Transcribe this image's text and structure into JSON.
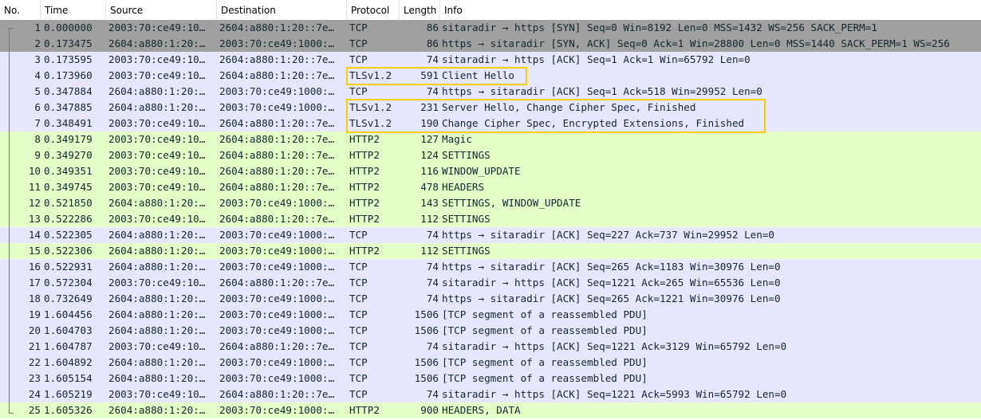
{
  "columns": {
    "no": "No.",
    "time": "Time",
    "source": "Source",
    "destination": "Destination",
    "protocol": "Protocol",
    "length": "Length",
    "info": "Info"
  },
  "packets": [
    {
      "no": "1",
      "time": "0.000000",
      "src": "2003:70:ce49:10…",
      "dst": "2604:a880:1:20::7e…",
      "proto": "TCP",
      "len": "86",
      "info": "sitaradir → https [SYN] Seq=0 Win=8192 Len=0 MSS=1432 WS=256 SACK_PERM=1",
      "kind": "selected"
    },
    {
      "no": "2",
      "time": "0.173475",
      "src": "2604:a880:1:20:…",
      "dst": "2003:70:ce49:1000:…",
      "proto": "TCP",
      "len": "86",
      "info": "https → sitaradir [SYN, ACK] Seq=0 Ack=1 Win=28800 Len=0 MSS=1440 SACK_PERM=1 WS=256",
      "kind": "selected"
    },
    {
      "no": "3",
      "time": "0.173595",
      "src": "2003:70:ce49:10…",
      "dst": "2604:a880:1:20::7e…",
      "proto": "TCP",
      "len": "74",
      "info": "sitaradir → https [ACK] Seq=1 Ack=1 Win=65792 Len=0",
      "kind": "tcp"
    },
    {
      "no": "4",
      "time": "0.173960",
      "src": "2003:70:ce49:10…",
      "dst": "2604:a880:1:20::7e…",
      "proto": "TLSv1.2",
      "len": "591",
      "info": "Client Hello",
      "kind": "tls"
    },
    {
      "no": "5",
      "time": "0.347884",
      "src": "2604:a880:1:20:…",
      "dst": "2003:70:ce49:1000:…",
      "proto": "TCP",
      "len": "74",
      "info": "https → sitaradir [ACK] Seq=1 Ack=518 Win=29952 Len=0",
      "kind": "tcp"
    },
    {
      "no": "6",
      "time": "0.347885",
      "src": "2604:a880:1:20:…",
      "dst": "2003:70:ce49:1000:…",
      "proto": "TLSv1.2",
      "len": "231",
      "info": "Server Hello, Change Cipher Spec, Finished",
      "kind": "tls"
    },
    {
      "no": "7",
      "time": "0.348491",
      "src": "2003:70:ce49:10…",
      "dst": "2604:a880:1:20::7e…",
      "proto": "TLSv1.2",
      "len": "190",
      "info": "Change Cipher Spec, Encrypted Extensions, Finished",
      "kind": "tls"
    },
    {
      "no": "8",
      "time": "0.349179",
      "src": "2003:70:ce49:10…",
      "dst": "2604:a880:1:20::7e…",
      "proto": "HTTP2",
      "len": "127",
      "info": "Magic",
      "kind": "http2"
    },
    {
      "no": "9",
      "time": "0.349270",
      "src": "2003:70:ce49:10…",
      "dst": "2604:a880:1:20::7e…",
      "proto": "HTTP2",
      "len": "124",
      "info": "SETTINGS",
      "kind": "http2"
    },
    {
      "no": "10",
      "time": "0.349351",
      "src": "2003:70:ce49:10…",
      "dst": "2604:a880:1:20::7e…",
      "proto": "HTTP2",
      "len": "116",
      "info": "WINDOW_UPDATE",
      "kind": "http2"
    },
    {
      "no": "11",
      "time": "0.349745",
      "src": "2003:70:ce49:10…",
      "dst": "2604:a880:1:20::7e…",
      "proto": "HTTP2",
      "len": "478",
      "info": "HEADERS",
      "kind": "http2"
    },
    {
      "no": "12",
      "time": "0.521850",
      "src": "2604:a880:1:20:…",
      "dst": "2003:70:ce49:1000:…",
      "proto": "HTTP2",
      "len": "143",
      "info": "SETTINGS, WINDOW_UPDATE",
      "kind": "http2"
    },
    {
      "no": "13",
      "time": "0.522286",
      "src": "2003:70:ce49:10…",
      "dst": "2604:a880:1:20::7e…",
      "proto": "HTTP2",
      "len": "112",
      "info": "SETTINGS",
      "kind": "http2"
    },
    {
      "no": "14",
      "time": "0.522305",
      "src": "2604:a880:1:20:…",
      "dst": "2003:70:ce49:1000:…",
      "proto": "TCP",
      "len": "74",
      "info": "https → sitaradir [ACK] Seq=227 Ack=737 Win=29952 Len=0",
      "kind": "tcp"
    },
    {
      "no": "15",
      "time": "0.522306",
      "src": "2604:a880:1:20:…",
      "dst": "2003:70:ce49:1000:…",
      "proto": "HTTP2",
      "len": "112",
      "info": "SETTINGS",
      "kind": "http2"
    },
    {
      "no": "16",
      "time": "0.522931",
      "src": "2604:a880:1:20:…",
      "dst": "2003:70:ce49:1000:…",
      "proto": "TCP",
      "len": "74",
      "info": "https → sitaradir [ACK] Seq=265 Ack=1183 Win=30976 Len=0",
      "kind": "tcp"
    },
    {
      "no": "17",
      "time": "0.572304",
      "src": "2003:70:ce49:10…",
      "dst": "2604:a880:1:20::7e…",
      "proto": "TCP",
      "len": "74",
      "info": "sitaradir → https [ACK] Seq=1221 Ack=265 Win=65536 Len=0",
      "kind": "tcp"
    },
    {
      "no": "18",
      "time": "0.732649",
      "src": "2604:a880:1:20:…",
      "dst": "2003:70:ce49:1000:…",
      "proto": "TCP",
      "len": "74",
      "info": "https → sitaradir [ACK] Seq=265 Ack=1221 Win=30976 Len=0",
      "kind": "tcp"
    },
    {
      "no": "19",
      "time": "1.604456",
      "src": "2604:a880:1:20:…",
      "dst": "2003:70:ce49:1000:…",
      "proto": "TCP",
      "len": "1506",
      "info": "[TCP segment of a reassembled PDU]",
      "kind": "tcp"
    },
    {
      "no": "20",
      "time": "1.604703",
      "src": "2604:a880:1:20:…",
      "dst": "2003:70:ce49:1000:…",
      "proto": "TCP",
      "len": "1506",
      "info": "[TCP segment of a reassembled PDU]",
      "kind": "tcp"
    },
    {
      "no": "21",
      "time": "1.604787",
      "src": "2003:70:ce49:10…",
      "dst": "2604:a880:1:20::7e…",
      "proto": "TCP",
      "len": "74",
      "info": "sitaradir → https [ACK] Seq=1221 Ack=3129 Win=65792 Len=0",
      "kind": "tcp"
    },
    {
      "no": "22",
      "time": "1.604892",
      "src": "2604:a880:1:20:…",
      "dst": "2003:70:ce49:1000:…",
      "proto": "TCP",
      "len": "1506",
      "info": "[TCP segment of a reassembled PDU]",
      "kind": "tcp"
    },
    {
      "no": "23",
      "time": "1.605154",
      "src": "2604:a880:1:20:…",
      "dst": "2003:70:ce49:1000:…",
      "proto": "TCP",
      "len": "1506",
      "info": "[TCP segment of a reassembled PDU]",
      "kind": "tcp"
    },
    {
      "no": "24",
      "time": "1.605219",
      "src": "2003:70:ce49:10…",
      "dst": "2604:a880:1:20::7e…",
      "proto": "TCP",
      "len": "74",
      "info": "sitaradir → https [ACK] Seq=1221 Ack=5993 Win=65792 Len=0",
      "kind": "tcp"
    },
    {
      "no": "25",
      "time": "1.605326",
      "src": "2604:a880:1:20:…",
      "dst": "2003:70:ce49:1000:…",
      "proto": "HTTP2",
      "len": "900",
      "info": "HEADERS, DATA",
      "kind": "http2"
    }
  ],
  "colors": {
    "tcp_row": "#e7e6ff",
    "http2_row": "#e4ffc7",
    "selected_row": "#a0a0a0",
    "highlight_box": "#f5d000"
  }
}
